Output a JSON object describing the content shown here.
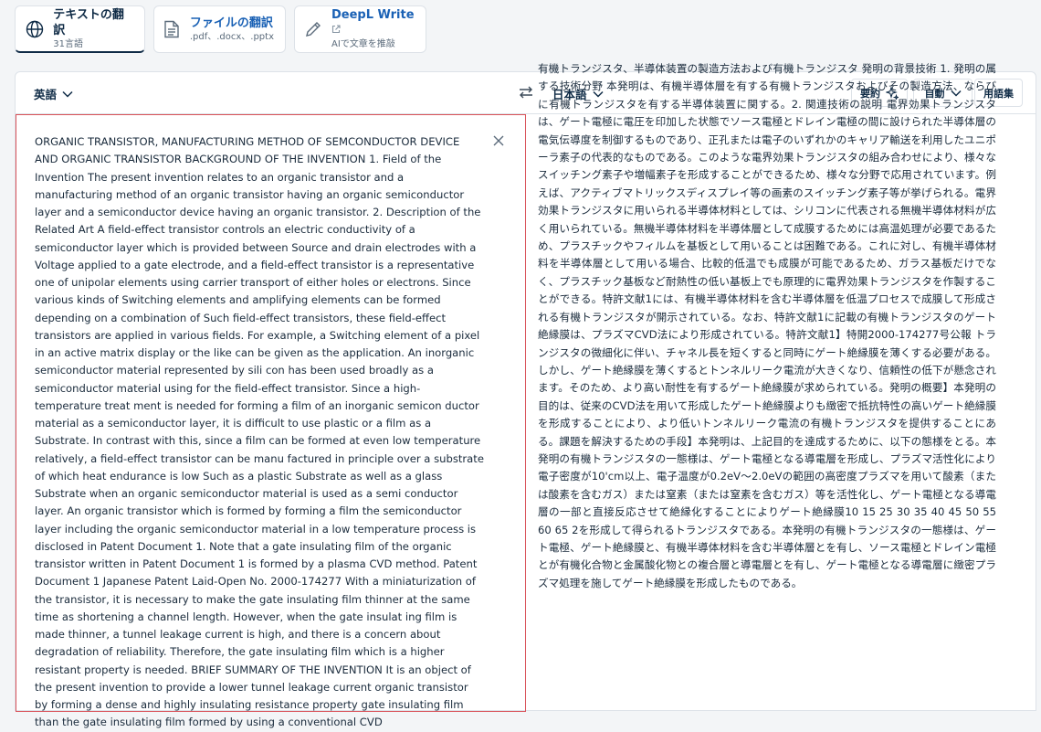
{
  "tabs": [
    {
      "title": "テキストの翻訳",
      "subtitle": "31言語",
      "icon": "globe-icon"
    },
    {
      "title": "ファイルの翻訳",
      "subtitle": ".pdf、.docx、.pptx",
      "icon": "document-icon"
    },
    {
      "title": "DeepL Write",
      "subtitle": "AIで文章を推敲",
      "icon": "pen-icon",
      "external_icon": "external-link-icon"
    }
  ],
  "header": {
    "source_language": "英語",
    "target_language": "日本語",
    "summary_label": "要約",
    "auto_label": "自動",
    "glossary_label": "用語集"
  },
  "source": {
    "text": "ORGANIC TRANSISTOR, MANUFACTURING METHOD OF SEMCONDUCTOR DEVICE AND ORGANIC TRANSISTOR BACKGROUND OF THE INVENTION 1. Field of the Invention The present invention relates to an organic transistor and a manufacturing method of an organic transistor having an organic semiconductor layer and a semiconductor device having an organic transistor. 2. Description of the Related Art A field-effect transistor controls an electric conductivity of a semiconductor layer which is provided between Source and drain electrodes with a Voltage applied to a gate electrode, and a field-effect transistor is a representative one of unipolar elements using carrier transport of either holes or electrons. Since various kinds of Switching elements and amplifying elements can be formed depending on a combination of Such field-effect transistors, these field-effect transistors are applied in various fields. For example, a Switching element of a pixel in an active matrix display or the like can be given as the application. An inorganic semiconductor material represented by sili con has been used broadly as a semiconductor material using for the field-effect transistor. Since a high-temperature treat ment is needed for forming a film of an inorganic semicon ductor material as a semiconductor layer, it is difficult to use plastic or a film as a Substrate. In contrast with this, since a film can be formed at even low temperature relatively, a field-effect transistor can be manu factured in principle over a substrate of which heat endurance is low Such as a plastic Substrate as well as a glass Substrate when an organic semiconductor material is used as a semi conductor layer. An organic transistor which is formed by forming a film the semiconductor layer including the organic semiconductor material in a low temperature process is disclosed in Patent Document 1. Note that a gate insulating film of the organic transistor written in Patent Document 1 is formed by a plasma CVD method. Patent Document 1 Japanese Patent Laid-Open No. 2000-174277 With a miniaturization of the transistor, it is necessary to make the gate insulating film thinner at the same time as shortening a channel length. However, when the gate insulat ing film is made thinner, a tunnel leakage current is high, and there is a concern about degradation of reliability. Therefore, the gate insulating film which is a higher resistant property is needed. BRIEF SUMMARY OF THE INVENTION It is an object of the present invention to provide a lower tunnel leakage current organic transistor by forming a dense and highly insulating resistance property gate insulating film than the gate insulating film formed by using a conventional CVD"
  },
  "target": {
    "text": "有機トランジスタ、半導体装置の製造方法および有機トランジスタ 発明の背景技術 1. 発明の属する技術分野 本発明は、有機半導体層を有する有機トランジスタおよびその製造方法、ならびに有機トランジスタを有する半導体装置に関する。2. 関連技術の説明 電界効果トランジスタは、ゲート電極に電圧を印加した状態でソース電極とドレイン電極の間に設けられた半導体層の電気伝導度を制御するものであり、正孔または電子のいずれかのキャリア輸送を利用したユニポーラ素子の代表的なものである。このような電界効果トランジスタの組み合わせにより、様々なスイッチング素子や増幅素子を形成することができるため、様々な分野で応用されています。例えば、アクティブマトリックスディスプレイ等の画素のスイッチング素子等が挙げられる。電界効果トランジスタに用いられる半導体材料としては、シリコンに代表される無機半導体材料が広く用いられている。無機半導体材料を半導体層として成膜するためには高温処理が必要であるため、プラスチックやフィルムを基板として用いることは困難である。これに対し、有機半導体材料を半導体層として用いる場合、比較的低温でも成膜が可能であるため、ガラス基板だけでなく、プラスチック基板など耐熱性の低い基板上でも原理的に電界効果トランジスタを作製することができる。特許文献1には、有機半導体材料を含む半導体層を低温プロセスで成膜して形成される有機トランジスタが開示されている。なお、特許文献1に記載の有機トランジスタのゲート絶縁膜は、プラズマCVD法により形成されている。特許文献1】特開2000-174277号公報 トランジスタの微細化に伴い、チャネル長を短くすると同時にゲート絶縁膜を薄くする必要がある。しかし、ゲート絶縁膜を薄くするとトンネルリーク電流が大きくなり、信頼性の低下が懸念されます。そのため、より高い耐性を有するゲート絶縁膜が求められている。発明の概要】本発明の目的は、従来のCVD法を用いて形成したゲート絶縁膜よりも緻密で抵抗特性の高いゲート絶縁膜を形成することにより、より低いトンネルリーク電流の有機トランジスタを提供することにある。課題を解決するための手段】本発明は、上記目的を達成するために、以下の態様をとる。本発明の有機トランジスタの一態様は、ゲート電極となる導電層を形成し、プラズマ活性化により電子密度が10'cm以上、電子温度が0.2eV～2.0eVの範囲の高密度プラズマを用いて酸素（または酸素を含むガス）または窒素（または窒素を含むガス）等を活性化し、ゲート電極となる導電層の一部と直接反応させて絶縁化することによりゲート絶縁膜10 15 25 30 35 40 45 50 55 60 65 2を形成して得られるトランジスタである。本発明の有機トランジスタの一態様は、ゲート電極、ゲート絶縁膜と、有機半導体材料を含む半導体層とを有し、ソース電極とドレイン電極とが有機化合物と金属酸化物との複合層と導電層とを有し、ゲート電極となる導電層に緻密プラズマ処理を施してゲート絶縁膜を形成したものである。"
  }
}
